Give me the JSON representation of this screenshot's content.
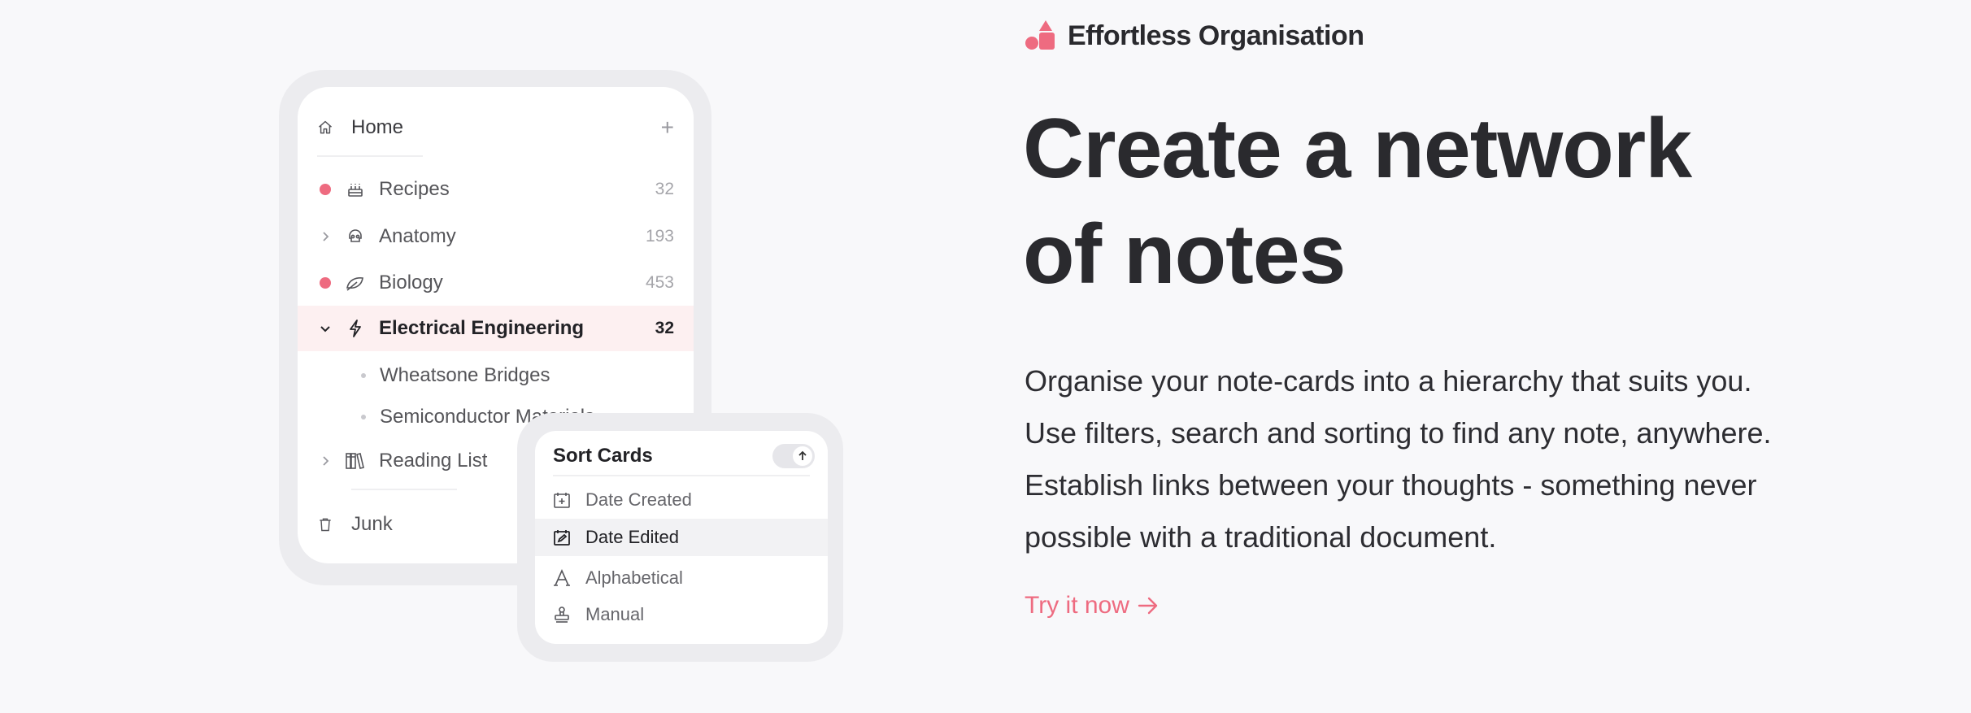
{
  "brand": {
    "color": "#ee6b80"
  },
  "sidebar": {
    "home_label": "Home",
    "add_symbol": "+",
    "items": [
      {
        "label": "Recipes",
        "count": "32",
        "icon": "cake-icon",
        "marker": "dot"
      },
      {
        "label": "Anatomy",
        "count": "193",
        "icon": "skull-icon",
        "marker": "chevron-right"
      },
      {
        "label": "Biology",
        "count": "453",
        "icon": "leaf-icon",
        "marker": "dot"
      },
      {
        "label": "Electrical Engineering",
        "count": "32",
        "icon": "lightning-icon",
        "marker": "chevron-down",
        "active": true
      },
      {
        "label": "Wheatsone Bridges",
        "child": true
      },
      {
        "label": "Semiconductor Materials",
        "child": true
      },
      {
        "label": "Reading List",
        "icon": "books-icon",
        "marker": "chevron-right"
      }
    ],
    "junk_label": "Junk"
  },
  "sort_menu": {
    "title": "Sort Cards",
    "direction": "ascending",
    "options": [
      {
        "label": "Date Created",
        "icon": "calendar-plus-icon"
      },
      {
        "label": "Date Edited",
        "icon": "calendar-edit-icon",
        "selected": true
      },
      {
        "label": "Alphabetical",
        "icon": "letter-a-icon"
      },
      {
        "label": "Manual",
        "icon": "stamp-icon"
      }
    ]
  },
  "hero": {
    "badge": "Effortless Organisation",
    "headline_line1": "Create a network",
    "headline_line2": "of notes",
    "body_line1": "Organise your note-cards into a hierarchy that suits you.",
    "body_line2": "Use filters, search and sorting to find any note, anywhere.",
    "body_line3": "Establish links between your thoughts - something never",
    "body_line4": "possible with a traditional document.",
    "cta": "Try it now"
  }
}
